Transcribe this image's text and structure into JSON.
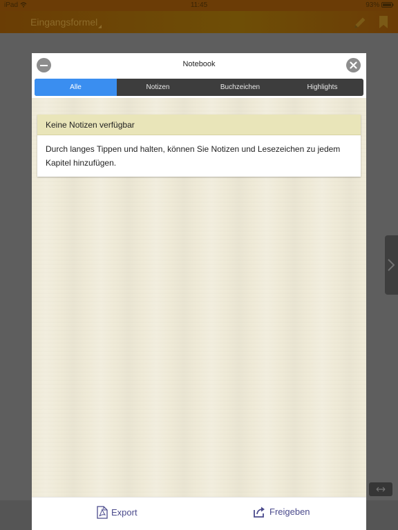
{
  "status_bar": {
    "device": "iPad",
    "time": "11:45",
    "battery": "93%"
  },
  "app": {
    "title": "Eingangsformel"
  },
  "modal": {
    "title": "Notebook",
    "tabs": [
      {
        "label": "Alle",
        "active": true
      },
      {
        "label": "Notizen",
        "active": false
      },
      {
        "label": "Buchzeichen",
        "active": false
      },
      {
        "label": "Highlights",
        "active": false
      }
    ],
    "empty_card": {
      "heading": "Keine Notizen verfügbar",
      "body": "Durch langes Tippen und halten, können Sie Notizen und Lesezeichen zu jedem Kapitel hinzufügen."
    },
    "footer": {
      "export_label": "Export",
      "share_label": "Freigeben"
    }
  },
  "colors": {
    "accent": "#3a8ef0",
    "card_header": "#e9e5b9",
    "footer_text": "#4a4a8c",
    "app_header": "#6b3c06"
  },
  "icons": [
    "wifi-icon",
    "pencil-icon",
    "bookmark-icon",
    "chevron-right-icon",
    "resize-icon",
    "minus-icon",
    "close-icon",
    "pdf-icon",
    "share-icon"
  ]
}
